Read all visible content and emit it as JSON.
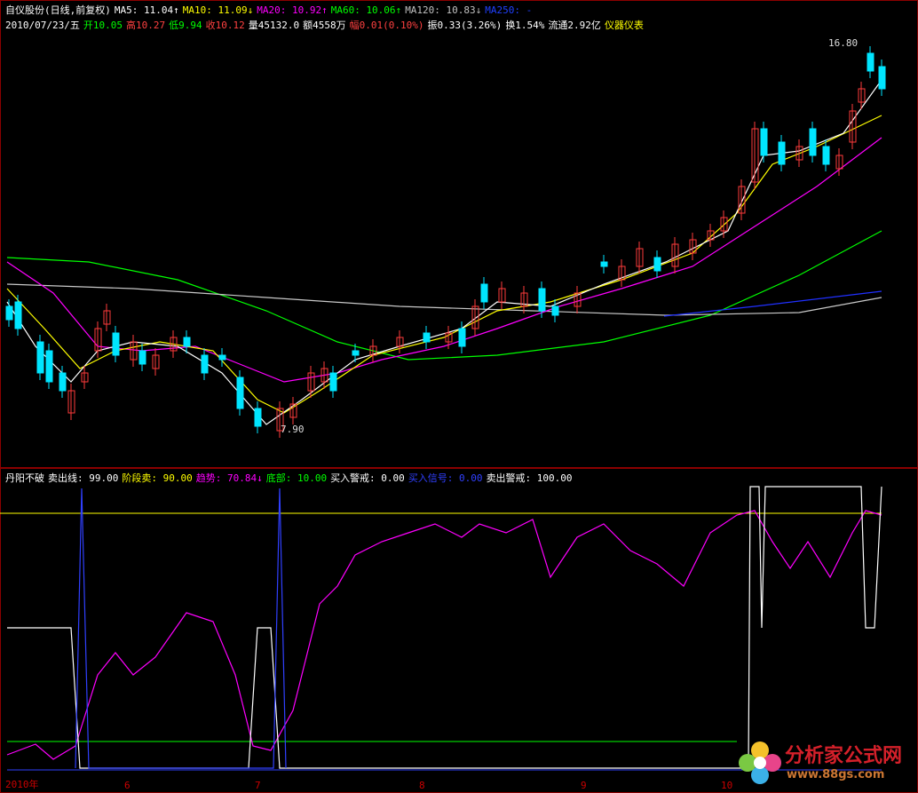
{
  "header": {
    "line1": [
      {
        "text": "自仪股份(日线,前复权)",
        "color": "#ffffff"
      },
      {
        "text": "MA5: 11.04↑",
        "color": "#ffffff"
      },
      {
        "text": "MA10: 11.09↓",
        "color": "#ffff00"
      },
      {
        "text": "MA20: 10.92↑",
        "color": "#ff00ff"
      },
      {
        "text": "MA60: 10.06↑",
        "color": "#00ff00"
      },
      {
        "text": "MA120: 10.83↓",
        "color": "#c0c0c0"
      },
      {
        "text": "MA250: -",
        "color": "#2040ff"
      }
    ],
    "line2": [
      {
        "text": "2010/07/23/五",
        "color": "#ffffff"
      },
      {
        "text": "开10.05",
        "color": "#00ff00"
      },
      {
        "text": "高10.27",
        "color": "#ff4040"
      },
      {
        "text": "低9.94",
        "color": "#00ff00"
      },
      {
        "text": "收10.12",
        "color": "#ff4040"
      },
      {
        "text": "量45132.0",
        "color": "#ffffff"
      },
      {
        "text": "额4558万",
        "color": "#ffffff"
      },
      {
        "text": "幅0.01(0.10%)",
        "color": "#ff4040"
      },
      {
        "text": "振0.33(3.26%)",
        "color": "#ffffff"
      },
      {
        "text": "换1.54%",
        "color": "#ffffff"
      },
      {
        "text": "流通2.92亿",
        "color": "#ffffff"
      },
      {
        "text": "仪器仪表",
        "color": "#ffff00"
      }
    ]
  },
  "price_labels": {
    "high": "16.80",
    "low": "7.90"
  },
  "indicator": {
    "line": [
      {
        "text": "丹阳不破",
        "color": "#ffffff"
      },
      {
        "text": "卖出线: 99.00",
        "color": "#ffffff"
      },
      {
        "text": "阶段卖: 90.00",
        "color": "#ffff00"
      },
      {
        "text": "趋势: 70.84↓",
        "color": "#ff00ff"
      },
      {
        "text": "底部: 10.00",
        "color": "#00ff00"
      },
      {
        "text": "买入警戒: 0.00",
        "color": "#ffffff"
      },
      {
        "text": "买入信号: 0.00",
        "color": "#3040ff"
      },
      {
        "text": "卖出警戒: 100.00",
        "color": "#ffffff"
      }
    ]
  },
  "x_axis": {
    "labels": [
      "2010年",
      "6",
      "7",
      "8",
      "9",
      "10"
    ]
  },
  "logo": {
    "name": "分析家公式网",
    "url": "www.88gs.com"
  },
  "colors": {
    "up": "#ff3b3b",
    "down": "#00e5ff",
    "ma5": "#ffffff",
    "ma10": "#ffff00",
    "ma20": "#ff00ff",
    "ma60": "#00ff00",
    "ma120": "#c8c8c8",
    "ma250": "#2030ff"
  }
}
